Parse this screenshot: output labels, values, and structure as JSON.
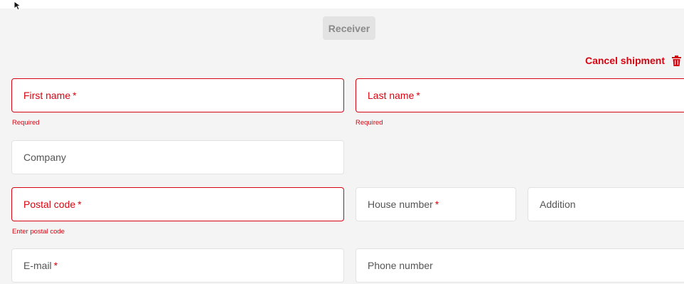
{
  "header": {
    "receiver_label": "Receiver",
    "cancel_label": "Cancel shipment",
    "cancel_icon": "trash-icon"
  },
  "form": {
    "first_name": {
      "label": "First name",
      "required_mark": "*",
      "error": "Required"
    },
    "last_name": {
      "label": "Last name",
      "required_mark": "*",
      "error": "Required"
    },
    "company": {
      "label": "Company"
    },
    "postal_code": {
      "label": "Postal code",
      "required_mark": "*",
      "error": "Enter postal code"
    },
    "house_number": {
      "label": "House number",
      "required_mark": "*"
    },
    "addition": {
      "label": "Addition"
    },
    "email": {
      "label": "E-mail",
      "required_mark": "*"
    },
    "phone": {
      "label": "Phone number"
    }
  },
  "colors": {
    "accent_red": "#d40511",
    "panel_bg": "#f4f4f4",
    "badge_bg": "#e3e3e3"
  }
}
